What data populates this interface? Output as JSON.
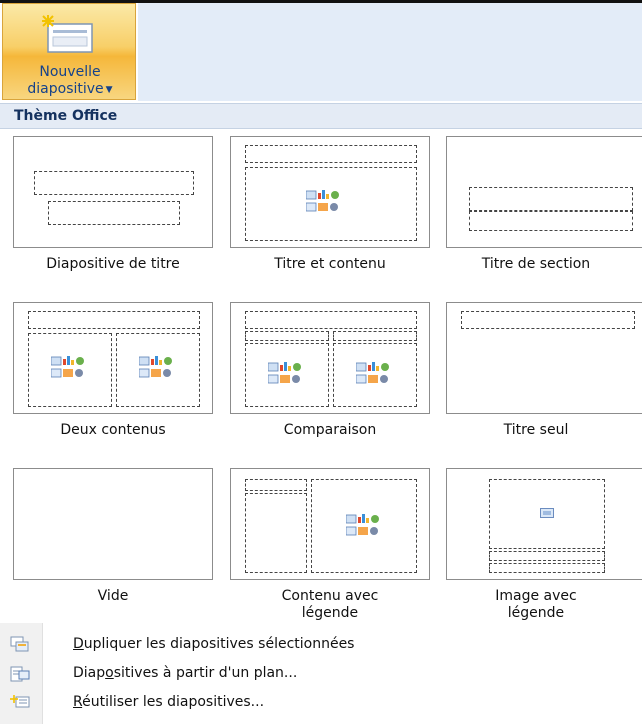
{
  "ribbon": {
    "new_slide_button": {
      "label": "Nouvelle\ndiapositive",
      "dropdown_icon": "chevron-down-icon",
      "icon": "new-slide-icon"
    }
  },
  "gallery": {
    "header": "Thème Office",
    "layouts": [
      {
        "label": "Diapositive de titre"
      },
      {
        "label": "Titre et contenu"
      },
      {
        "label": "Titre de section"
      },
      {
        "label": "Deux contenus"
      },
      {
        "label": "Comparaison"
      },
      {
        "label": "Titre seul"
      },
      {
        "label": "Vide"
      },
      {
        "label": "Contenu avec\nlégende"
      },
      {
        "label": "Image avec\nlégende"
      }
    ]
  },
  "menu": {
    "items": [
      {
        "pre": "",
        "key": "D",
        "post": "upliquer les diapositives sélectionnées",
        "icon": "duplicate-slides-icon"
      },
      {
        "pre": "Diap",
        "key": "o",
        "post": "sitives à partir d'un plan...",
        "icon": "slides-from-outline-icon"
      },
      {
        "pre": "",
        "key": "R",
        "post": "éutiliser les diapositives...",
        "icon": "reuse-slides-icon"
      }
    ]
  },
  "colors": {
    "button_gold": "#f5b73a",
    "ribbon_blue": "#e3ecf8",
    "header_text": "#15325f",
    "button_text": "#15428b"
  }
}
